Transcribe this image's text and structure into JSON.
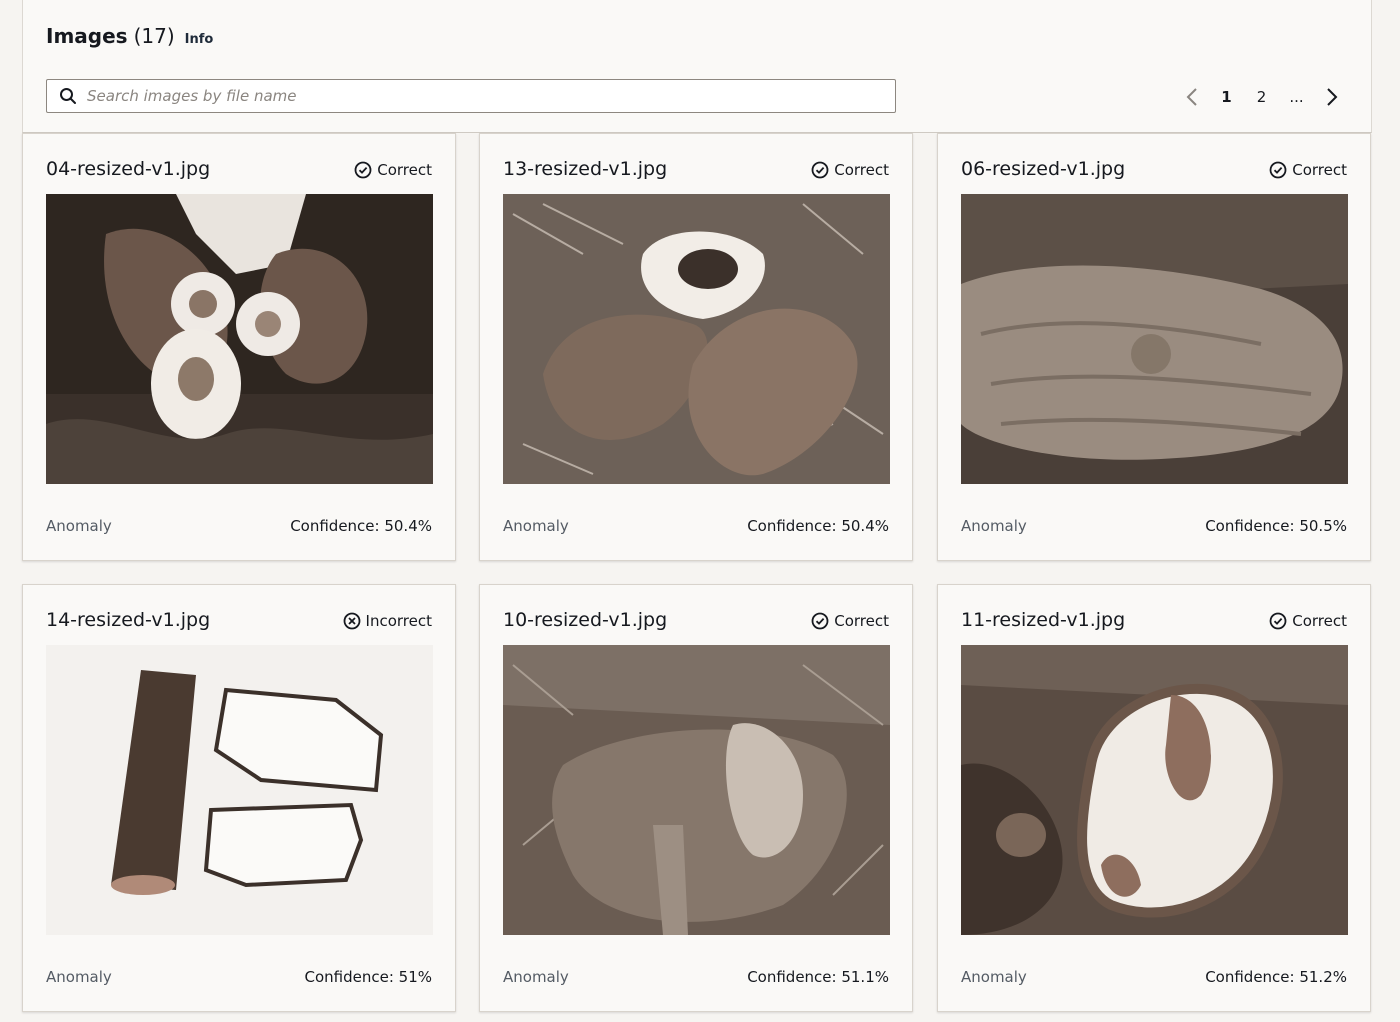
{
  "header": {
    "title": "Images",
    "count": "(17)",
    "info_link": "Info"
  },
  "search": {
    "placeholder": "Search images by file name",
    "icon": "search-icon"
  },
  "pagination": {
    "pages": [
      "1",
      "2",
      "..."
    ],
    "current_page": "1",
    "prev_icon": "chevron-left-icon",
    "next_icon": "chevron-right-icon"
  },
  "cards": [
    {
      "filename": "04-resized-v1.jpg",
      "status": "Correct",
      "status_icon": "check-circle-icon",
      "label": "Anomaly",
      "confidence": "Confidence: 50.4%"
    },
    {
      "filename": "13-resized-v1.jpg",
      "status": "Correct",
      "status_icon": "check-circle-icon",
      "label": "Anomaly",
      "confidence": "Confidence: 50.4%"
    },
    {
      "filename": "06-resized-v1.jpg",
      "status": "Correct",
      "status_icon": "check-circle-icon",
      "label": "Anomaly",
      "confidence": "Confidence: 50.5%"
    },
    {
      "filename": "14-resized-v1.jpg",
      "status": "Incorrect",
      "status_icon": "x-circle-icon",
      "label": "Anomaly",
      "confidence": "Confidence: 51%"
    },
    {
      "filename": "10-resized-v1.jpg",
      "status": "Correct",
      "status_icon": "check-circle-icon",
      "label": "Anomaly",
      "confidence": "Confidence: 51.1%"
    },
    {
      "filename": "11-resized-v1.jpg",
      "status": "Correct",
      "status_icon": "check-circle-icon",
      "label": "Anomaly",
      "confidence": "Confidence: 51.2%"
    }
  ],
  "colors": {
    "background": "#f6f4f1",
    "card": "#faf9f7",
    "text": "#16191f",
    "muted_text": "#545b64"
  }
}
